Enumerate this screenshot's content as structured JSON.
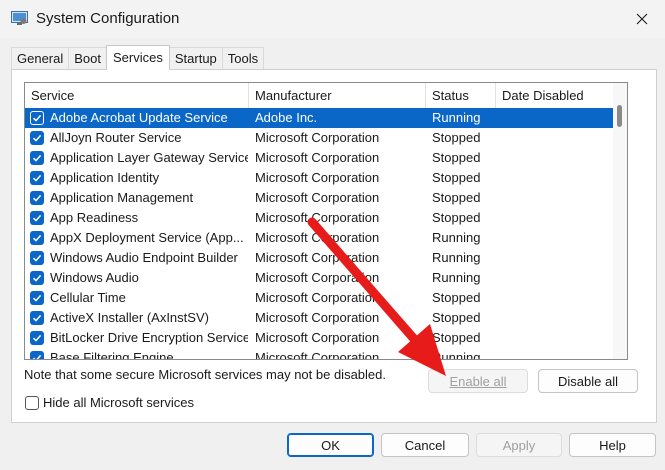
{
  "window": {
    "title": "System Configuration"
  },
  "tabs": [
    {
      "label": "General"
    },
    {
      "label": "Boot"
    },
    {
      "label": "Services",
      "active": true
    },
    {
      "label": "Startup"
    },
    {
      "label": "Tools"
    }
  ],
  "columns": {
    "service": "Service",
    "manufacturer": "Manufacturer",
    "status": "Status",
    "date_disabled": "Date Disabled"
  },
  "services": [
    {
      "name": "Adobe Acrobat Update Service",
      "manufacturer": "Adobe Inc.",
      "status": "Running",
      "date": "",
      "checked": true,
      "selected": true
    },
    {
      "name": "AllJoyn Router Service",
      "manufacturer": "Microsoft Corporation",
      "status": "Stopped",
      "date": "",
      "checked": true
    },
    {
      "name": "Application Layer Gateway Service",
      "manufacturer": "Microsoft Corporation",
      "status": "Stopped",
      "date": "",
      "checked": true
    },
    {
      "name": "Application Identity",
      "manufacturer": "Microsoft Corporation",
      "status": "Stopped",
      "date": "",
      "checked": true
    },
    {
      "name": "Application Management",
      "manufacturer": "Microsoft Corporation",
      "status": "Stopped",
      "date": "",
      "checked": true
    },
    {
      "name": "App Readiness",
      "manufacturer": "Microsoft Corporation",
      "status": "Stopped",
      "date": "",
      "checked": true
    },
    {
      "name": "AppX Deployment Service (App...",
      "manufacturer": "Microsoft Corporation",
      "status": "Running",
      "date": "",
      "checked": true
    },
    {
      "name": "Windows Audio Endpoint Builder",
      "manufacturer": "Microsoft Corporation",
      "status": "Running",
      "date": "",
      "checked": true
    },
    {
      "name": "Windows Audio",
      "manufacturer": "Microsoft Corporation",
      "status": "Running",
      "date": "",
      "checked": true
    },
    {
      "name": "Cellular Time",
      "manufacturer": "Microsoft Corporation",
      "status": "Stopped",
      "date": "",
      "checked": true
    },
    {
      "name": "ActiveX Installer (AxInstSV)",
      "manufacturer": "Microsoft Corporation",
      "status": "Stopped",
      "date": "",
      "checked": true
    },
    {
      "name": "BitLocker Drive Encryption Service",
      "manufacturer": "Microsoft Corporation",
      "status": "Stopped",
      "date": "",
      "checked": true
    },
    {
      "name": "Base Filtering Engine",
      "manufacturer": "Microsoft Corporation",
      "status": "Running",
      "date": "",
      "checked": true
    }
  ],
  "note": "Note that some secure Microsoft services may not be disabled.",
  "enable_all": "Enable all",
  "disable_all": "Disable all",
  "hide_ms_label": "Hide all Microsoft services",
  "hide_ms_checked": false,
  "footer": {
    "ok": "OK",
    "cancel": "Cancel",
    "apply": "Apply",
    "help": "Help"
  },
  "colors": {
    "accent": "#0a67c8",
    "annotation_arrow": "#e81b1b"
  }
}
